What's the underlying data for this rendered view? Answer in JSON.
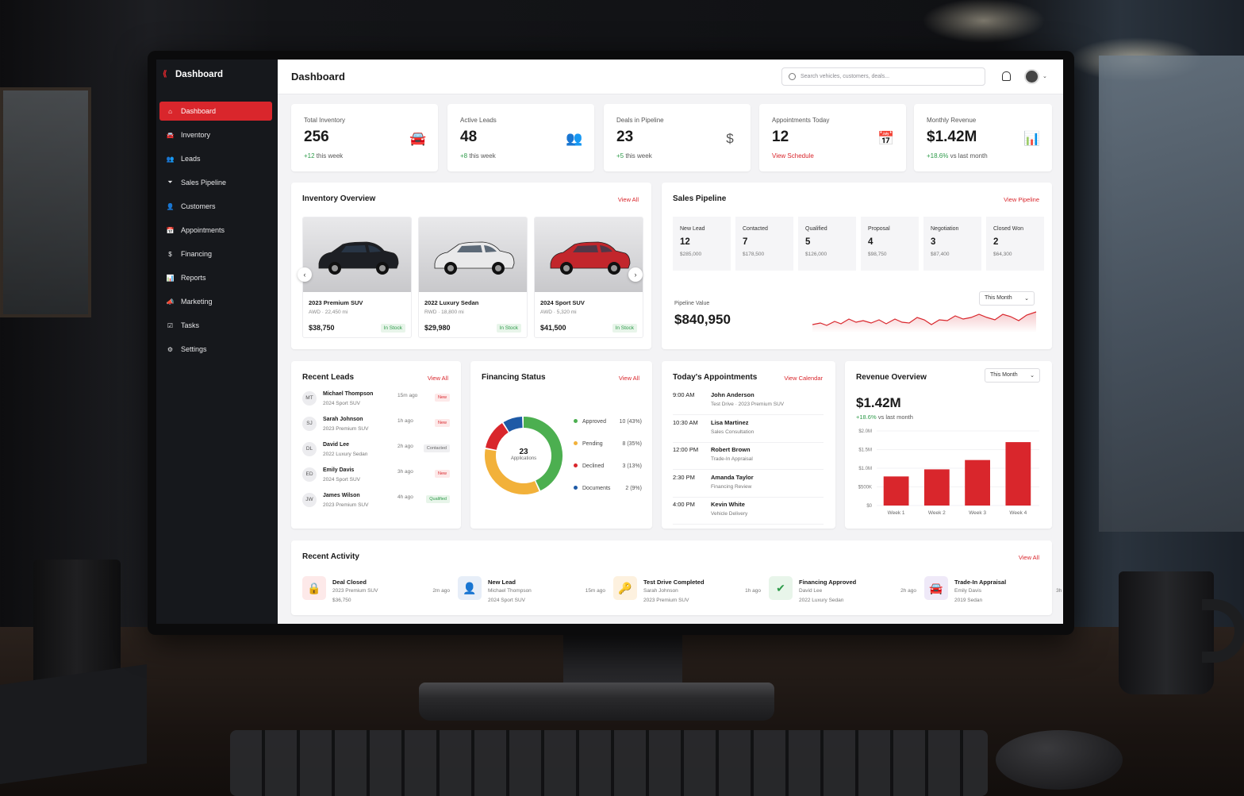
{
  "app": {
    "brand": "Dashboard"
  },
  "sidebar": {
    "items": [
      {
        "label": "Dashboard",
        "icon": "home-icon",
        "active": true
      },
      {
        "label": "Inventory",
        "icon": "car-icon"
      },
      {
        "label": "Leads",
        "icon": "users-icon"
      },
      {
        "label": "Sales Pipeline",
        "icon": "funnel-icon"
      },
      {
        "label": "Customers",
        "icon": "user-icon"
      },
      {
        "label": "Appointments",
        "icon": "calendar-icon"
      },
      {
        "label": "Financing",
        "icon": "dollar-icon"
      },
      {
        "label": "Reports",
        "icon": "bar-chart-icon"
      },
      {
        "label": "Marketing",
        "icon": "megaphone-icon"
      },
      {
        "label": "Tasks",
        "icon": "checklist-icon"
      },
      {
        "label": "Settings",
        "icon": "gear-icon"
      }
    ]
  },
  "header": {
    "title": "Dashboard",
    "search_placeholder": "Search vehicles, customers, deals..."
  },
  "kpis": [
    {
      "label": "Total Inventory",
      "value": "256",
      "delta": "+12",
      "delta_text": " this week",
      "icon": "car-icon"
    },
    {
      "label": "Active Leads",
      "value": "48",
      "delta": "+8",
      "delta_text": " this week",
      "icon": "users-icon"
    },
    {
      "label": "Deals in Pipeline",
      "value": "23",
      "delta": "+5",
      "delta_text": " this week",
      "icon": "dollar-circle-icon"
    },
    {
      "label": "Appointments Today",
      "value": "12",
      "link": "View Schedule",
      "icon": "calendar-icon"
    },
    {
      "label": "Monthly Revenue",
      "value": "$1.42M",
      "delta": "+18.6%",
      "delta_text": " vs last month",
      "icon": "bar-chart-icon"
    }
  ],
  "inventory": {
    "title": "Inventory Overview",
    "link": "View All",
    "cars": [
      {
        "name": "2023 Premium SUV",
        "spec": "AWD · 22,450 mi",
        "price": "$38,750",
        "status": "In Stock",
        "color": "#1d1f24"
      },
      {
        "name": "2022 Luxury Sedan",
        "spec": "RWD · 18,800 mi",
        "price": "$29,980",
        "status": "In Stock",
        "color": "#e9e9ea"
      },
      {
        "name": "2024 Sport SUV",
        "spec": "AWD · 5,320 mi",
        "price": "$41,500",
        "status": "In Stock",
        "color": "#c2262c"
      }
    ]
  },
  "pipeline": {
    "title": "Sales Pipeline",
    "link": "View Pipeline",
    "stages": [
      {
        "name": "New Lead",
        "count": "12",
        "value": "$285,000"
      },
      {
        "name": "Contacted",
        "count": "7",
        "value": "$178,500"
      },
      {
        "name": "Qualified",
        "count": "5",
        "value": "$126,000"
      },
      {
        "name": "Proposal",
        "count": "4",
        "value": "$98,750"
      },
      {
        "name": "Negotiation",
        "count": "3",
        "value": "$87,400"
      },
      {
        "name": "Closed Won",
        "count": "2",
        "value": "$64,300"
      }
    ],
    "value_label": "Pipeline Value",
    "value": "$840,950",
    "period": "This Month"
  },
  "leads": {
    "title": "Recent Leads",
    "link": "View All",
    "items": [
      {
        "initials": "MT",
        "name": "Michael Thompson",
        "car": "2024 Sport SUV",
        "time": "15m ago",
        "status": "New",
        "kind": "new"
      },
      {
        "initials": "SJ",
        "name": "Sarah Johnson",
        "car": "2023 Premium SUV",
        "time": "1h ago",
        "status": "New",
        "kind": "new"
      },
      {
        "initials": "DL",
        "name": "David Lee",
        "car": "2022 Luxury Sedan",
        "time": "2h ago",
        "status": "Contacted",
        "kind": "contacted"
      },
      {
        "initials": "ED",
        "name": "Emily Davis",
        "car": "2024 Sport SUV",
        "time": "3h ago",
        "status": "New",
        "kind": "new"
      },
      {
        "initials": "JW",
        "name": "James Wilson",
        "car": "2023 Premium SUV",
        "time": "4h ago",
        "status": "Qualified",
        "kind": "qualified"
      }
    ]
  },
  "financing": {
    "title": "Financing Status",
    "link": "View All",
    "total": "23",
    "total_label": "Applications",
    "rows": [
      {
        "label": "Approved",
        "value": "10 (43%)",
        "count": 10,
        "color": "#4caf50"
      },
      {
        "label": "Pending",
        "value": "8 (35%)",
        "count": 8,
        "color": "#f2b13a"
      },
      {
        "label": "Declined",
        "value": "3 (13%)",
        "count": 3,
        "color": "#d9262c"
      },
      {
        "label": "Documents",
        "value": "2 (9%)",
        "count": 2,
        "color": "#1e5aa6"
      }
    ]
  },
  "appointments": {
    "title": "Today's Appointments",
    "link": "View Calendar",
    "items": [
      {
        "time": "9:00 AM",
        "name": "John Anderson",
        "desc": "Test Drive · 2023 Premium SUV"
      },
      {
        "time": "10:30 AM",
        "name": "Lisa Martinez",
        "desc": "Sales Consultation"
      },
      {
        "time": "12:00 PM",
        "name": "Robert Brown",
        "desc": "Trade-In Appraisal"
      },
      {
        "time": "2:30 PM",
        "name": "Amanda Taylor",
        "desc": "Financing Review"
      },
      {
        "time": "4:00 PM",
        "name": "Kevin White",
        "desc": "Vehicle Delivery"
      }
    ]
  },
  "revenue": {
    "title": "Revenue Overview",
    "period": "This Month",
    "value": "$1.42M",
    "delta": "+18.6%",
    "delta_text": " vs last month"
  },
  "chart_data": {
    "type": "bar",
    "categories": [
      "Week 1",
      "Week 2",
      "Week 3",
      "Week 4"
    ],
    "values": [
      0.78,
      0.97,
      1.22,
      1.7
    ],
    "ylim": [
      0,
      2.0
    ],
    "yticks": [
      0,
      0.5,
      1.0,
      1.5,
      2.0
    ],
    "ytick_labels": [
      "$0",
      "$500K",
      "$1.0M",
      "$1.5M",
      "$2.0M"
    ],
    "grid": true,
    "color": "#d9262c"
  },
  "activity": {
    "title": "Recent Activity",
    "link": "View All",
    "items": [
      {
        "title": "Deal Closed",
        "l1": "2023 Premium SUV",
        "l2": "$36,750",
        "time": "2m ago",
        "icon": "lock-icon",
        "bg": "#fde9e9",
        "fg": "#d9262c"
      },
      {
        "title": "New Lead",
        "l1": "Michael Thompson",
        "l2": "2024 Sport SUV",
        "time": "15m ago",
        "icon": "user-icon",
        "bg": "#e7eef8",
        "fg": "#1e5aa6"
      },
      {
        "title": "Test Drive Completed",
        "l1": "Sarah Johnson",
        "l2": "2023 Premium SUV",
        "time": "1h ago",
        "icon": "key-icon",
        "bg": "#fdf1df",
        "fg": "#e3962b"
      },
      {
        "title": "Financing Approved",
        "l1": "David Lee",
        "l2": "2022 Luxury Sedan",
        "time": "2h ago",
        "icon": "check-icon",
        "bg": "#e8f5ea",
        "fg": "#2e9b4a"
      },
      {
        "title": "Trade-In Appraisal",
        "l1": "Emily Davis",
        "l2": "2019 Sedan",
        "time": "3h ago",
        "icon": "car-icon",
        "bg": "#efe9f8",
        "fg": "#6b4fb8"
      }
    ]
  }
}
